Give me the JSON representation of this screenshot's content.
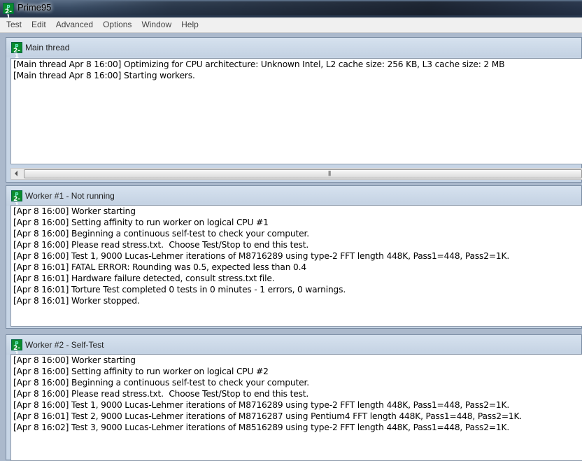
{
  "window": {
    "title": "Prime95",
    "icon": "prime95-icon"
  },
  "menu": [
    "Test",
    "Edit",
    "Advanced",
    "Options",
    "Window",
    "Help"
  ],
  "main_thread": {
    "title": "Main thread",
    "lines": [
      "[Main thread Apr 8 16:00] Optimizing for CPU architecture: Unknown Intel, L2 cache size: 256 KB, L3 cache size: 2 MB",
      "[Main thread Apr 8 16:00] Starting workers."
    ]
  },
  "worker1": {
    "title": "Worker #1 - Not running",
    "lines": [
      "[Apr 8 16:00] Worker starting",
      "[Apr 8 16:00] Setting affinity to run worker on logical CPU #1",
      "[Apr 8 16:00] Beginning a continuous self-test to check your computer.",
      "[Apr 8 16:00] Please read stress.txt.  Choose Test/Stop to end this test.",
      "[Apr 8 16:00] Test 1, 9000 Lucas-Lehmer iterations of M8716289 using type-2 FFT length 448K, Pass1=448, Pass2=1K.",
      "[Apr 8 16:01] FATAL ERROR: Rounding was 0.5, expected less than 0.4",
      "[Apr 8 16:01] Hardware failure detected, consult stress.txt file.",
      "[Apr 8 16:01] Torture Test completed 0 tests in 0 minutes - 1 errors, 0 warnings.",
      "[Apr 8 16:01] Worker stopped."
    ]
  },
  "worker2": {
    "title": "Worker #2 - Self-Test",
    "lines": [
      "[Apr 8 16:00] Worker starting",
      "[Apr 8 16:00] Setting affinity to run worker on logical CPU #2",
      "[Apr 8 16:00] Beginning a continuous self-test to check your computer.",
      "[Apr 8 16:00] Please read stress.txt.  Choose Test/Stop to end this test.",
      "[Apr 8 16:00] Test 1, 9000 Lucas-Lehmer iterations of M8716289 using type-2 FFT length 448K, Pass1=448, Pass2=1K.",
      "[Apr 8 16:01] Test 2, 9000 Lucas-Lehmer iterations of M8716287 using Pentium4 FFT length 448K, Pass1=448, Pass2=1K.",
      "[Apr 8 16:02] Test 3, 9000 Lucas-Lehmer iterations of M8516289 using type-2 FFT length 448K, Pass1=448, Pass2=1K."
    ]
  }
}
